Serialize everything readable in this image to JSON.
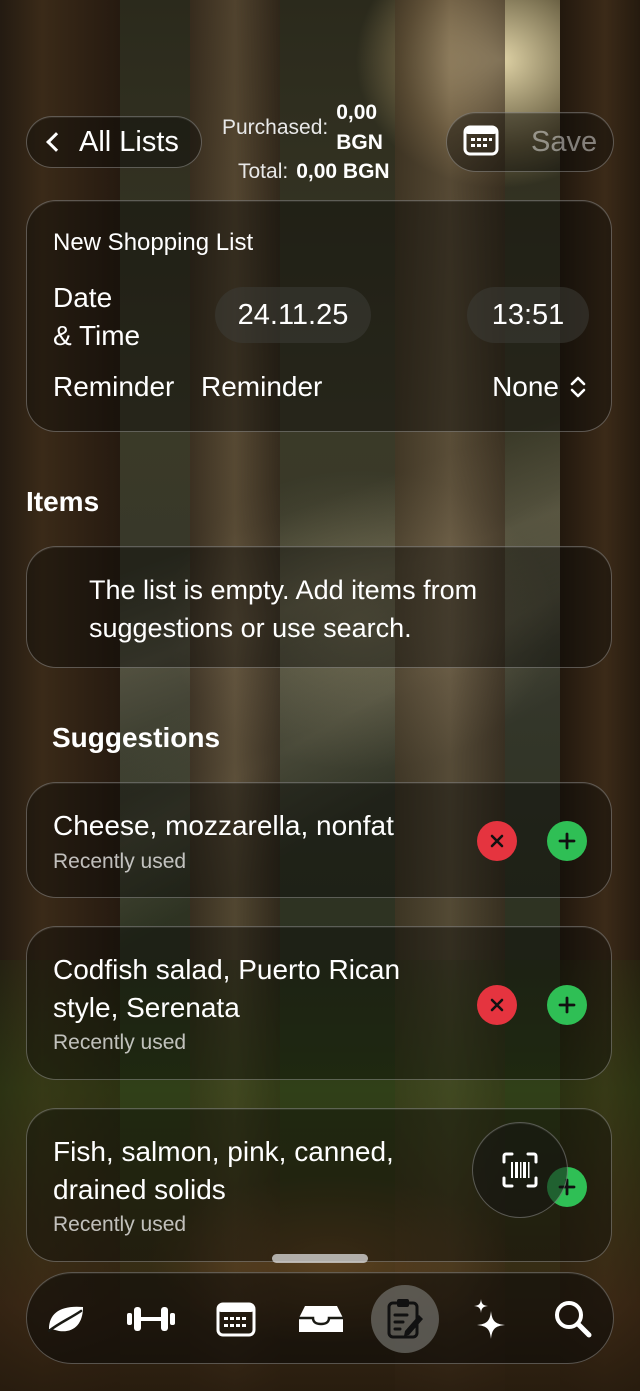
{
  "header": {
    "back_label": "All Lists",
    "purchased_label": "Purchased:",
    "purchased_value_line1": "0,00",
    "purchased_value_line2": "BGN",
    "total_label": "Total:",
    "total_value": "0,00 BGN",
    "save_label": "Save"
  },
  "details": {
    "list_name": "New Shopping List",
    "datetime_label_line1": "Date",
    "datetime_label_line2": "& Time",
    "date_value": "24.11.25",
    "time_value": "13:51",
    "reminder_label": "Reminder",
    "reminder_label2": "Reminder",
    "reminder_value": "None"
  },
  "items": {
    "heading": "Items",
    "empty_message": "The list is empty. Add items from suggestions or use search."
  },
  "suggestions": {
    "heading": "Suggestions",
    "entries": [
      {
        "name": "Cheese, mozzarella, nonfat",
        "sub": "Recently used"
      },
      {
        "name": "Codfish salad, Puerto Rican style, Serenata",
        "sub": "Recently used"
      },
      {
        "name": "Fish, salmon, pink, canned, drained solids",
        "sub": "Recently used"
      }
    ]
  },
  "tabs": [
    {
      "icon": "leaf-icon"
    },
    {
      "icon": "dumbbell-icon"
    },
    {
      "icon": "calendar-icon"
    },
    {
      "icon": "tray-icon"
    },
    {
      "icon": "clipboard-edit-icon",
      "active": true
    },
    {
      "icon": "sparkles-icon"
    },
    {
      "icon": "search-icon"
    }
  ],
  "colors": {
    "remove": "#e5343f",
    "add": "#2fbf55"
  }
}
